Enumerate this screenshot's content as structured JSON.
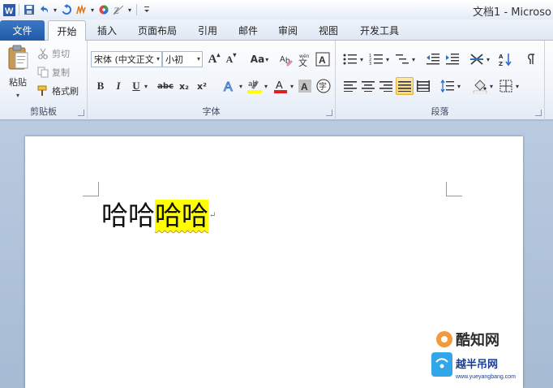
{
  "window": {
    "title": "文档1 - Microso"
  },
  "tabs": {
    "file": "文件",
    "items": [
      "开始",
      "插入",
      "页面布局",
      "引用",
      "邮件",
      "审阅",
      "视图",
      "开发工具"
    ],
    "active": "开始"
  },
  "clipboard": {
    "paste": "粘贴",
    "cut": "剪切",
    "copy": "复制",
    "format_painter": "格式刷",
    "label": "剪贴板"
  },
  "font": {
    "font_name": "宋体 (中文正文",
    "font_size": "小初",
    "label": "字体",
    "bold": "B",
    "italic": "I",
    "underline": "U",
    "strike": "abc",
    "subscript": "x₂",
    "superscript": "x²",
    "grow": "A",
    "shrink": "A",
    "case": "Aa",
    "font_color": "A",
    "char_shading": "A",
    "enclose": "字",
    "phonetic": "文",
    "highlight_color": "#ffff00",
    "font_color_value": "#e02020"
  },
  "paragraph": {
    "label": "段落"
  },
  "document": {
    "text_plain": "哈哈",
    "text_highlighted": "哈哈",
    "paragraph_mark": "↵"
  },
  "watermark": {
    "brand": "酷知网",
    "brand2": "越半吊网",
    "url": "www.yueyangbang.com"
  }
}
